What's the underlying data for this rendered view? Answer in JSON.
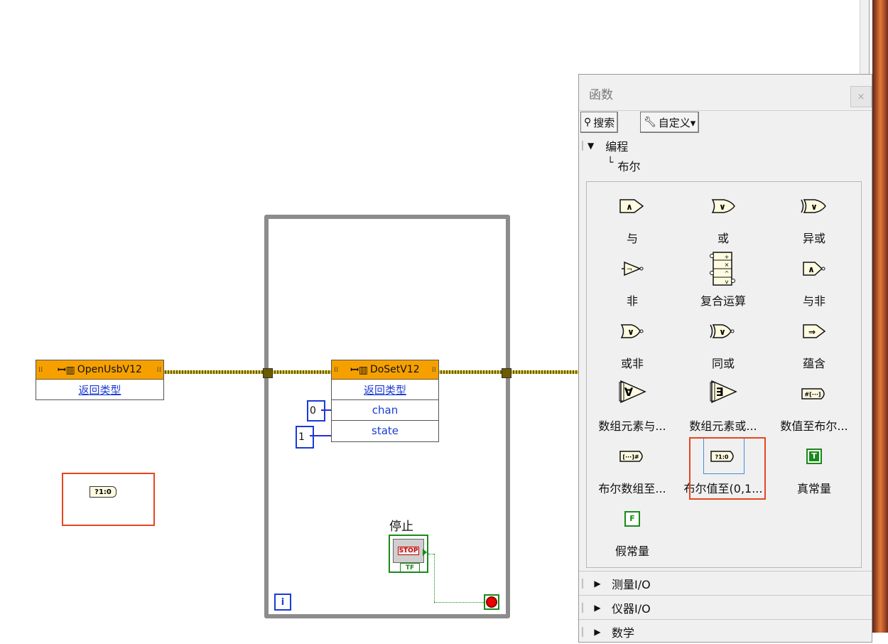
{
  "diagram": {
    "open_node": {
      "name": "OpenUsbV12",
      "rows": [
        "返回类型"
      ]
    },
    "doset_node": {
      "name": "DoSetV12",
      "rows": [
        "返回类型",
        "chan",
        "state"
      ]
    },
    "const_chan": "0",
    "const_state": "1",
    "stop_label": "停止",
    "stop_text": "STOP",
    "tf_text": "TF",
    "iteration": "i",
    "loose_node_text": "?1:0"
  },
  "palette": {
    "title": "函数",
    "close": "×",
    "search_label": "搜索",
    "customize_label": "自定义▾",
    "category": "编程",
    "subcategory": "布尔",
    "items": [
      {
        "label": "与",
        "icon": "and-icon"
      },
      {
        "label": "或",
        "icon": "or-icon"
      },
      {
        "label": "异或",
        "icon": "xor-icon"
      },
      {
        "label": "非",
        "icon": "not-icon"
      },
      {
        "label": "复合运算",
        "icon": "compound-arithmetic-icon"
      },
      {
        "label": "与非",
        "icon": "nand-icon"
      },
      {
        "label": "或非",
        "icon": "nor-icon"
      },
      {
        "label": "同或",
        "icon": "xnor-icon"
      },
      {
        "label": "蕴含",
        "icon": "implies-icon"
      },
      {
        "label": "数组元素与...",
        "icon": "and-array-icon"
      },
      {
        "label": "数组元素或...",
        "icon": "or-array-icon"
      },
      {
        "label": "数值至布尔...",
        "icon": "number-to-boolean-icon"
      },
      {
        "label": "布尔数组至...",
        "icon": "boolean-array-to-number-icon"
      },
      {
        "label": "布尔值至(0,1...",
        "icon": "boolean-to-01-icon"
      },
      {
        "label": "真常量",
        "icon": "true-constant-icon"
      },
      {
        "label": "假常量",
        "icon": "false-constant-icon"
      }
    ],
    "icon_text": {
      "and": "∧",
      "or": "∨",
      "xor": "∨",
      "nand": "∧",
      "nor": "∨",
      "xnor": "∨",
      "implies": "⇒",
      "true": "T",
      "false": "F",
      "num_to_bool": "#[···]",
      "bool_to_num": "[···]#",
      "bool01": "?1:0"
    },
    "collapsed_categories": [
      "测量I/O",
      "仪器I/O",
      "数学"
    ],
    "colors": {
      "highlight": "#e8451f",
      "node_orange": "#f6a000",
      "link_blue": "#1a3bd6"
    }
  }
}
